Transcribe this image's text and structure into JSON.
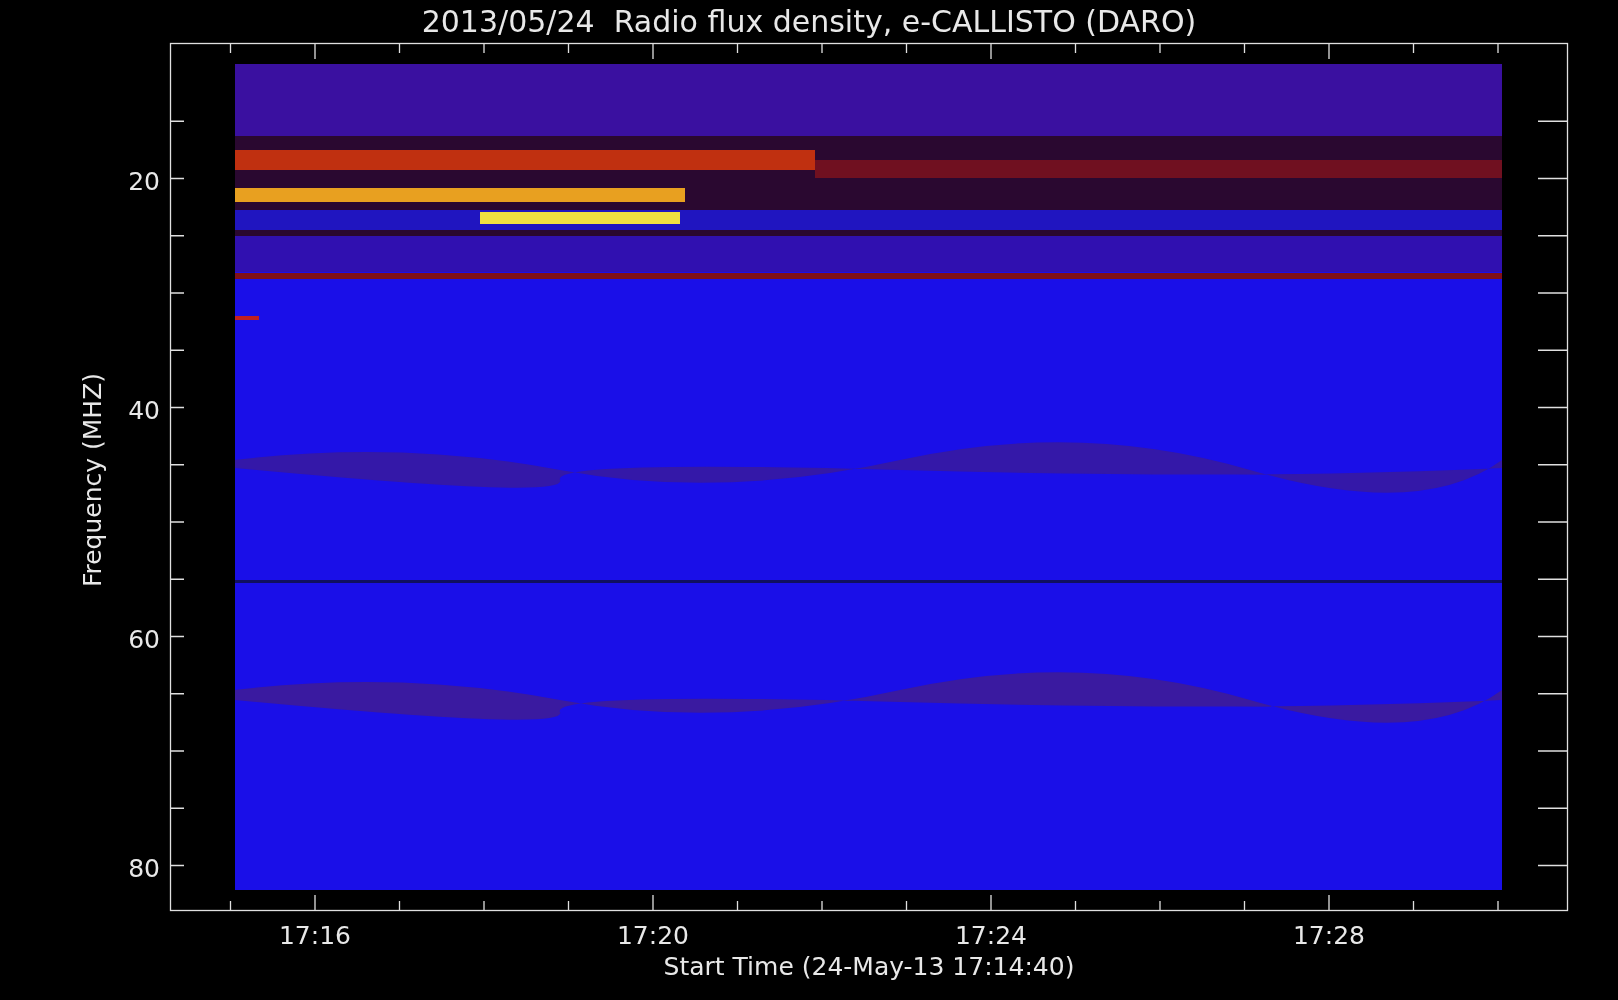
{
  "title": "2013/05/24  Radio flux density, e-CALLISTO (DARO)",
  "y_axis": {
    "label": "Frequency (MHZ)",
    "ticks": [
      "20",
      "40",
      "60",
      "80"
    ]
  },
  "x_axis": {
    "label": "Start Time (24-May-13 17:14:40)",
    "ticks": [
      "17:16",
      "17:20",
      "17:24",
      "17:28"
    ]
  }
}
